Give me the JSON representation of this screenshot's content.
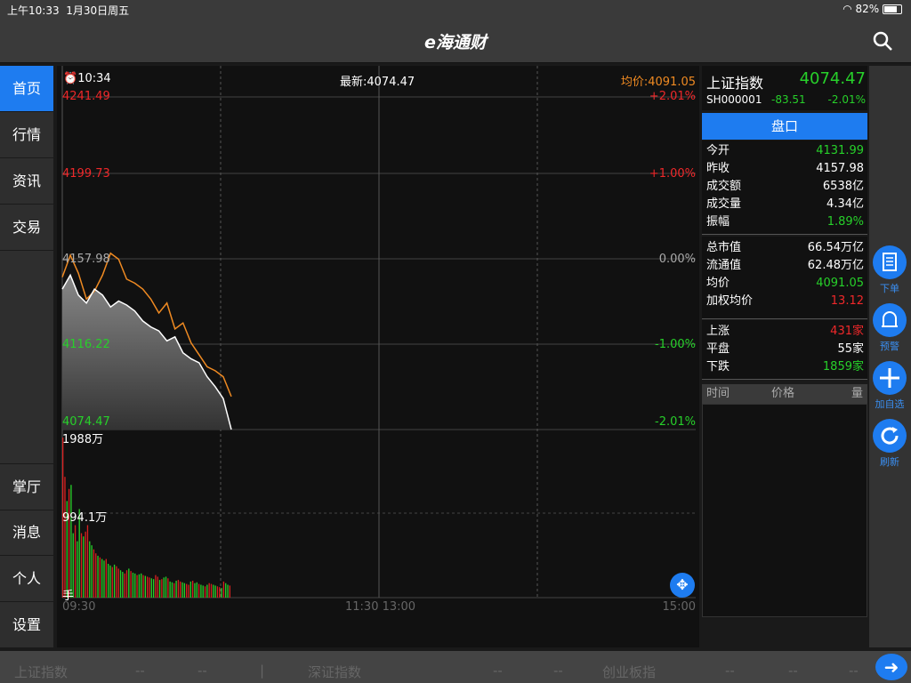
{
  "status": {
    "time": "上午10:33",
    "date": "1月30日周五",
    "battery": "82%"
  },
  "nav": {
    "logo": "e海通财"
  },
  "sidebar": {
    "top": [
      {
        "label": "首页"
      },
      {
        "label": "行情"
      },
      {
        "label": "资讯"
      },
      {
        "label": "交易"
      }
    ],
    "bottom": [
      {
        "label": "掌厅"
      },
      {
        "label": "消息"
      },
      {
        "label": "个人"
      },
      {
        "label": "设置"
      }
    ]
  },
  "chart": {
    "time_label": "10:34",
    "latest_label": "最新:4074.47",
    "avg_label": "均价:4091.05",
    "price_ticks": [
      "4241.49",
      "4199.73",
      "4157.98",
      "4116.22",
      "4074.47"
    ],
    "pct_ticks": [
      "+2.01%",
      "+1.00%",
      "0.00%",
      "-1.00%",
      "-2.01%"
    ],
    "vol_ticks": [
      "1988万",
      "994.1万",
      "手"
    ],
    "time_ticks": [
      "09:30",
      "11:30 13:00",
      "15:00"
    ]
  },
  "chart_data": {
    "type": "line",
    "title": "",
    "ylim": [
      4074.47,
      4241.49
    ],
    "x": [
      "09:30",
      "09:31",
      "09:32",
      "09:33",
      "09:34",
      "09:35",
      "09:36",
      "09:37",
      "09:38",
      "09:39",
      "09:40",
      "09:45",
      "09:50",
      "09:55",
      "10:00",
      "10:05",
      "10:10",
      "10:15",
      "10:20",
      "10:25",
      "10:30",
      "10:34"
    ],
    "series": [
      {
        "name": "最新",
        "values": [
          4145,
          4152,
          4142,
          4138,
          4145,
          4142,
          4136,
          4139,
          4137,
          4134,
          4129,
          4126,
          4124,
          4119,
          4121,
          4113,
          4110,
          4108,
          4101,
          4096,
          4090,
          4074.47
        ]
      },
      {
        "name": "均价",
        "values": [
          4151,
          4162,
          4153,
          4140,
          4144,
          4152,
          4163,
          4160,
          4150,
          4148,
          4145,
          4140,
          4133,
          4138,
          4125,
          4128,
          4118,
          4112,
          4106,
          4104,
          4101,
          4091.05
        ]
      }
    ],
    "volume": {
      "ylim": [
        0,
        1988
      ],
      "values": [
        1988,
        1500,
        1200,
        1350,
        1400,
        800,
        900,
        700,
        1100,
        800,
        760,
        820,
        900,
        700,
        650,
        600,
        550,
        520,
        500,
        480,
        460,
        480,
        420,
        400,
        380,
        410,
        390,
        360,
        340,
        320,
        300,
        340,
        360,
        330,
        310,
        300,
        280,
        290,
        300,
        280,
        270,
        260,
        250,
        240,
        230,
        280,
        260,
        220,
        230,
        250,
        260,
        240,
        200,
        190,
        180,
        210,
        220,
        200,
        190,
        180,
        170,
        160,
        200,
        210,
        180,
        190,
        170,
        160,
        150,
        140,
        160,
        180,
        170,
        160,
        150,
        140,
        130,
        120,
        200,
        180,
        160,
        150
      ]
    }
  },
  "quote": {
    "name": "上证指数",
    "price": "4074.47",
    "code": "SH000001",
    "change": "-83.51",
    "pct": "-2.01%",
    "tab": "盘口",
    "block1": [
      {
        "k": "今开",
        "v": "4131.99",
        "c": "green"
      },
      {
        "k": "昨收",
        "v": "4157.98",
        "c": "white"
      },
      {
        "k": "成交额",
        "v": "6538亿",
        "c": "white"
      },
      {
        "k": "成交量",
        "v": "4.34亿",
        "c": "white"
      },
      {
        "k": "振幅",
        "v": "1.89%",
        "c": "green"
      }
    ],
    "block2": [
      {
        "k": "总市值",
        "v": "66.54万亿",
        "c": "white"
      },
      {
        "k": "流通值",
        "v": "62.48万亿",
        "c": "white"
      },
      {
        "k": "均价",
        "v": "4091.05",
        "c": "green"
      },
      {
        "k": "加权均价",
        "v": "13.12",
        "c": "red"
      }
    ],
    "block3": [
      {
        "k": "上涨",
        "v": "431家",
        "c": "red"
      },
      {
        "k": "平盘",
        "v": "55家",
        "c": "white"
      },
      {
        "k": "下跌",
        "v": "1859家",
        "c": "green"
      }
    ],
    "trade_head": {
      "time": "时间",
      "price": "价格",
      "volume": "量"
    }
  },
  "actions": [
    {
      "label": "下单",
      "icon": "order-icon"
    },
    {
      "label": "预警",
      "icon": "alarm-bell-icon"
    },
    {
      "label": "加自选",
      "icon": "plus-icon"
    },
    {
      "label": "刷新",
      "icon": "refresh-icon"
    }
  ],
  "footer": {
    "i1": "上证指数",
    "i1a": "--",
    "i1b": "--",
    "i2": "深证指数",
    "i2a": "--",
    "i2b": "--",
    "i3": "创业板指",
    "i3a": "--",
    "i3b": "--"
  }
}
